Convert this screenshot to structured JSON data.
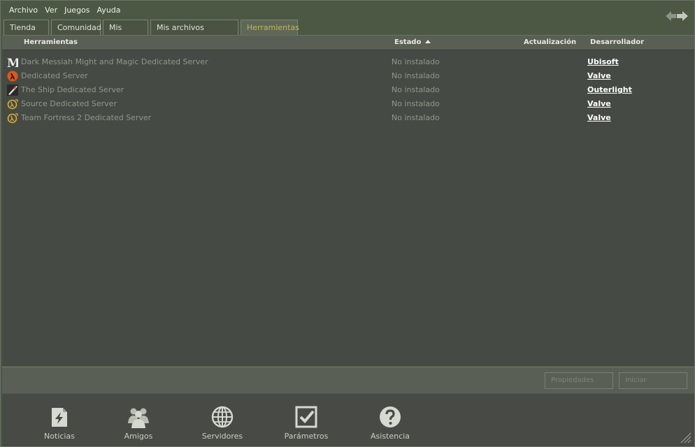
{
  "menu": [
    "Archivo",
    "Ver",
    "Juegos",
    "Ayuda"
  ],
  "tabs": [
    {
      "label": "Tienda"
    },
    {
      "label": "Comunidad"
    },
    {
      "label": "Mis juegos"
    },
    {
      "label": "Mis archivos multimedia"
    },
    {
      "label": "Herramientas"
    }
  ],
  "columns": {
    "name": "Herramientas",
    "status": "Estado",
    "update": "Actualización",
    "developer": "Desarrollador"
  },
  "rows": [
    {
      "icon": "dark-messiah-icon",
      "name": "Dark Messiah Might and Magic Dedicated Server",
      "status": "No instalado",
      "developer": "Ubisoft"
    },
    {
      "icon": "half-life-icon",
      "name": "Dedicated Server",
      "status": "No instalado",
      "developer": "Valve"
    },
    {
      "icon": "the-ship-icon",
      "name": "The Ship Dedicated Server",
      "status": "No instalado",
      "developer": "Outerlight"
    },
    {
      "icon": "source-icon",
      "name": "Source Dedicated Server",
      "status": "No instalado",
      "developer": "Valve"
    },
    {
      "icon": "source-icon",
      "name": "Team Fortress 2 Dedicated Server",
      "status": "No instalado",
      "developer": "Valve"
    }
  ],
  "buttons": {
    "properties": "Propiedades",
    "launch": "Iniciar"
  },
  "bottom": [
    {
      "label": "Noticias",
      "icon": "news-icon"
    },
    {
      "label": "Amigos",
      "icon": "friends-icon"
    },
    {
      "label": "Servidores",
      "icon": "servers-globe-icon"
    },
    {
      "label": "Parámetros",
      "icon": "settings-checkbox-icon"
    },
    {
      "label": "Asistencia",
      "icon": "help-icon"
    }
  ],
  "colors": {
    "background": "#4c5844",
    "list_background": "#464a44",
    "active_tab_text": "#c4b550",
    "developer_link": "#ffffff"
  }
}
